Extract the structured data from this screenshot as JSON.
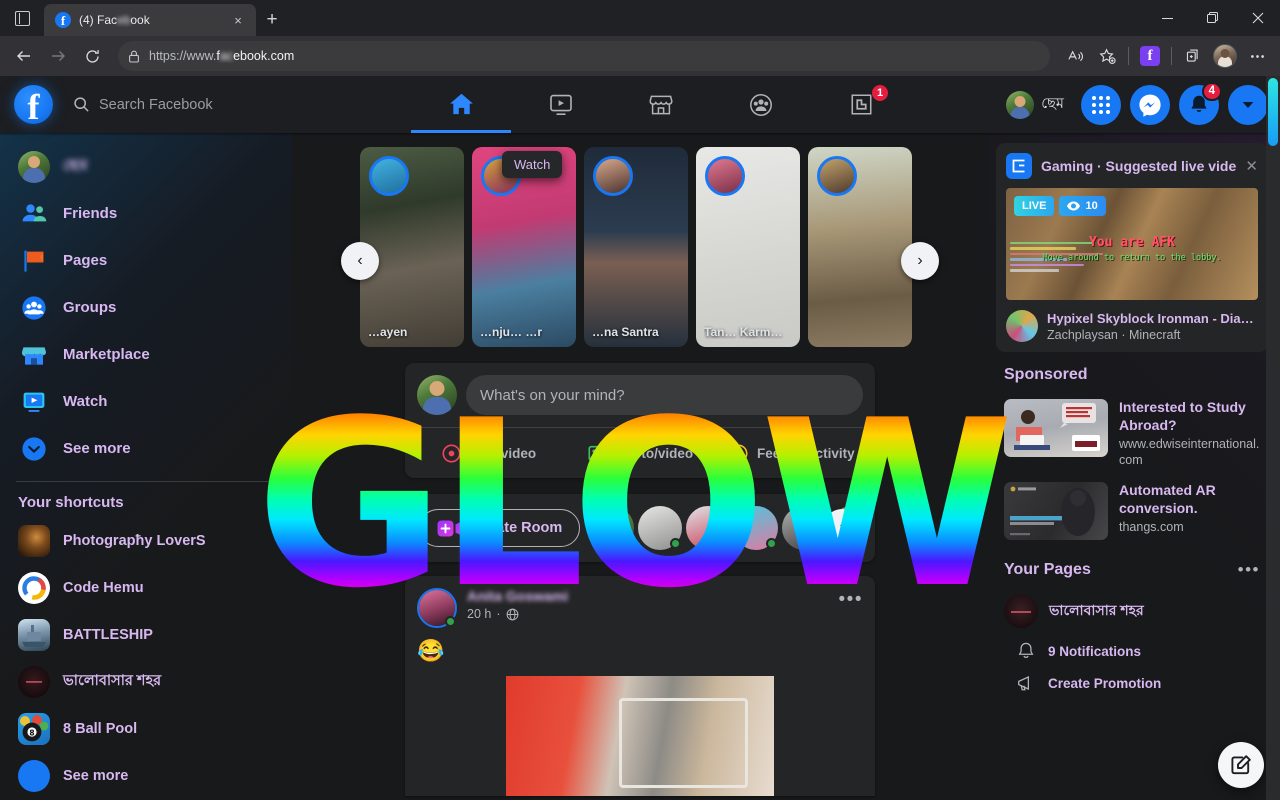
{
  "browser": {
    "tab": {
      "title": "(4) Facebook",
      "favicon": "facebook-icon"
    },
    "new_tab_label": "+",
    "close_label": "×",
    "url_scheme": "https://www.",
    "url_host": "facebook",
    "url_tld": ".com",
    "window": {
      "minimize": "—",
      "maximize": "❐",
      "close": "✕"
    }
  },
  "topnav": {
    "logo_letter": "f",
    "search_placeholder": "Search Facebook",
    "tabs": [
      {
        "name": "home",
        "label": "Home",
        "active": true,
        "badge": ""
      },
      {
        "name": "watch",
        "label": "Watch",
        "active": false,
        "badge": ""
      },
      {
        "name": "marketplace",
        "label": "Marketplace",
        "active": false,
        "badge": ""
      },
      {
        "name": "groups",
        "label": "Groups",
        "active": false,
        "badge": ""
      },
      {
        "name": "gaming",
        "label": "Gaming",
        "active": false,
        "badge": "1"
      }
    ],
    "profile_name": "ছেম",
    "menu_badge": "",
    "messenger_badge": "",
    "notifications_badge": "4"
  },
  "tooltip": {
    "label": "Watch"
  },
  "sidebar": {
    "profile_label": "ছেম",
    "items": [
      {
        "label": "Friends",
        "icon": "friends-icon"
      },
      {
        "label": "Pages",
        "icon": "pages-flag-icon"
      },
      {
        "label": "Groups",
        "icon": "groups-icon"
      },
      {
        "label": "Marketplace",
        "icon": "marketplace-icon"
      },
      {
        "label": "Watch",
        "icon": "watch-icon"
      },
      {
        "label": "See more",
        "icon": "chevron-down-icon"
      }
    ],
    "shortcuts_title": "Your shortcuts",
    "shortcuts": [
      {
        "label": "Photograpħy LoverS"
      },
      {
        "label": "Code Hemu"
      },
      {
        "label": "BATTLESHIP"
      },
      {
        "label": "ভালোবাসার শহর"
      },
      {
        "label": "8 Ball Pool"
      },
      {
        "label": "See more"
      }
    ]
  },
  "stories": {
    "prev_label": "‹",
    "next_label": "›",
    "items": [
      {
        "name": "…ayen"
      },
      {
        "name": "…nju… …r"
      },
      {
        "name": "…na Santra"
      },
      {
        "name": "Tan… Karm…"
      },
      {
        "name": ""
      }
    ]
  },
  "composer": {
    "placeholder": "What's on your mind?",
    "actions": [
      {
        "label": "Live video",
        "icon": "live-video-icon"
      },
      {
        "label": "Photo/video",
        "icon": "photo-video-icon"
      },
      {
        "label": "Feeling/activity",
        "icon": "feeling-icon"
      }
    ]
  },
  "rooms": {
    "create_label": "Create Room",
    "next_label": "›",
    "count": 6
  },
  "post": {
    "author": "Anita Goswami",
    "time": "20 h",
    "privacy_icon": "globe-icon",
    "menu_icon": "more-options-icon",
    "text": "😂"
  },
  "gaming": {
    "header": "Gaming · Suggested live video",
    "close_label": "✕",
    "live_label": "LIVE",
    "view_count": "10",
    "overlay_title": "You are AFK",
    "overlay_sub": "Move around to return to the lobby.",
    "video_title": "Hypixel Skyblock Ironman - Diana ...",
    "video_sub": "Zachplaysan · Minecraft"
  },
  "sponsored": {
    "title": "Sponsored",
    "ads": [
      {
        "title": "Interested to Study Abroad?",
        "url": "www.edwiseinternational.com"
      },
      {
        "title": "Automated AR conversion.",
        "url": "thangs.com"
      }
    ]
  },
  "your_pages": {
    "title": "Your Pages",
    "menu_label": "•••",
    "page_name": "ভালোবাসার শহর",
    "items": [
      {
        "label": "9 Notifications",
        "icon": "bell-icon"
      },
      {
        "label": "Create Promotion",
        "icon": "megaphone-icon"
      }
    ]
  },
  "fab": {
    "icon": "compose-icon"
  },
  "overlay": {
    "text": "GLOW"
  },
  "colors": {
    "fb_blue": "#1877f2",
    "accent_blue": "#2d88ff",
    "badge_red": "#e41e3f",
    "card_bg": "#242526",
    "page_bg": "#18191a",
    "text_primary": "#d7b8f0",
    "text_secondary": "#b0b3b8",
    "online_green": "#31a24c"
  }
}
